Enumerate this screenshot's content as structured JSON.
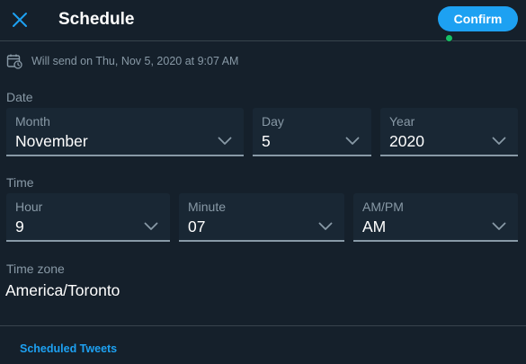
{
  "header": {
    "title": "Schedule",
    "confirm_label": "Confirm",
    "close_icon": "close-icon"
  },
  "info": {
    "will_send": "Will send on Thu, Nov 5, 2020 at 9:07 AM",
    "icon": "calendar-clock-icon"
  },
  "date": {
    "section_label": "Date",
    "month": {
      "label": "Month",
      "value": "November"
    },
    "day": {
      "label": "Day",
      "value": "5"
    },
    "year": {
      "label": "Year",
      "value": "2020"
    }
  },
  "time": {
    "section_label": "Time",
    "hour": {
      "label": "Hour",
      "value": "9"
    },
    "minute": {
      "label": "Minute",
      "value": "07"
    },
    "ampm": {
      "label": "AM/PM",
      "value": "AM"
    }
  },
  "timezone": {
    "section_label": "Time zone",
    "value": "America/Toronto"
  },
  "footer": {
    "scheduled_link": "Scheduled Tweets"
  },
  "colors": {
    "background": "#15202b",
    "field_background": "#192734",
    "accent": "#1da1f2",
    "muted_text": "#8899a6",
    "status_dot": "#17bf63"
  }
}
